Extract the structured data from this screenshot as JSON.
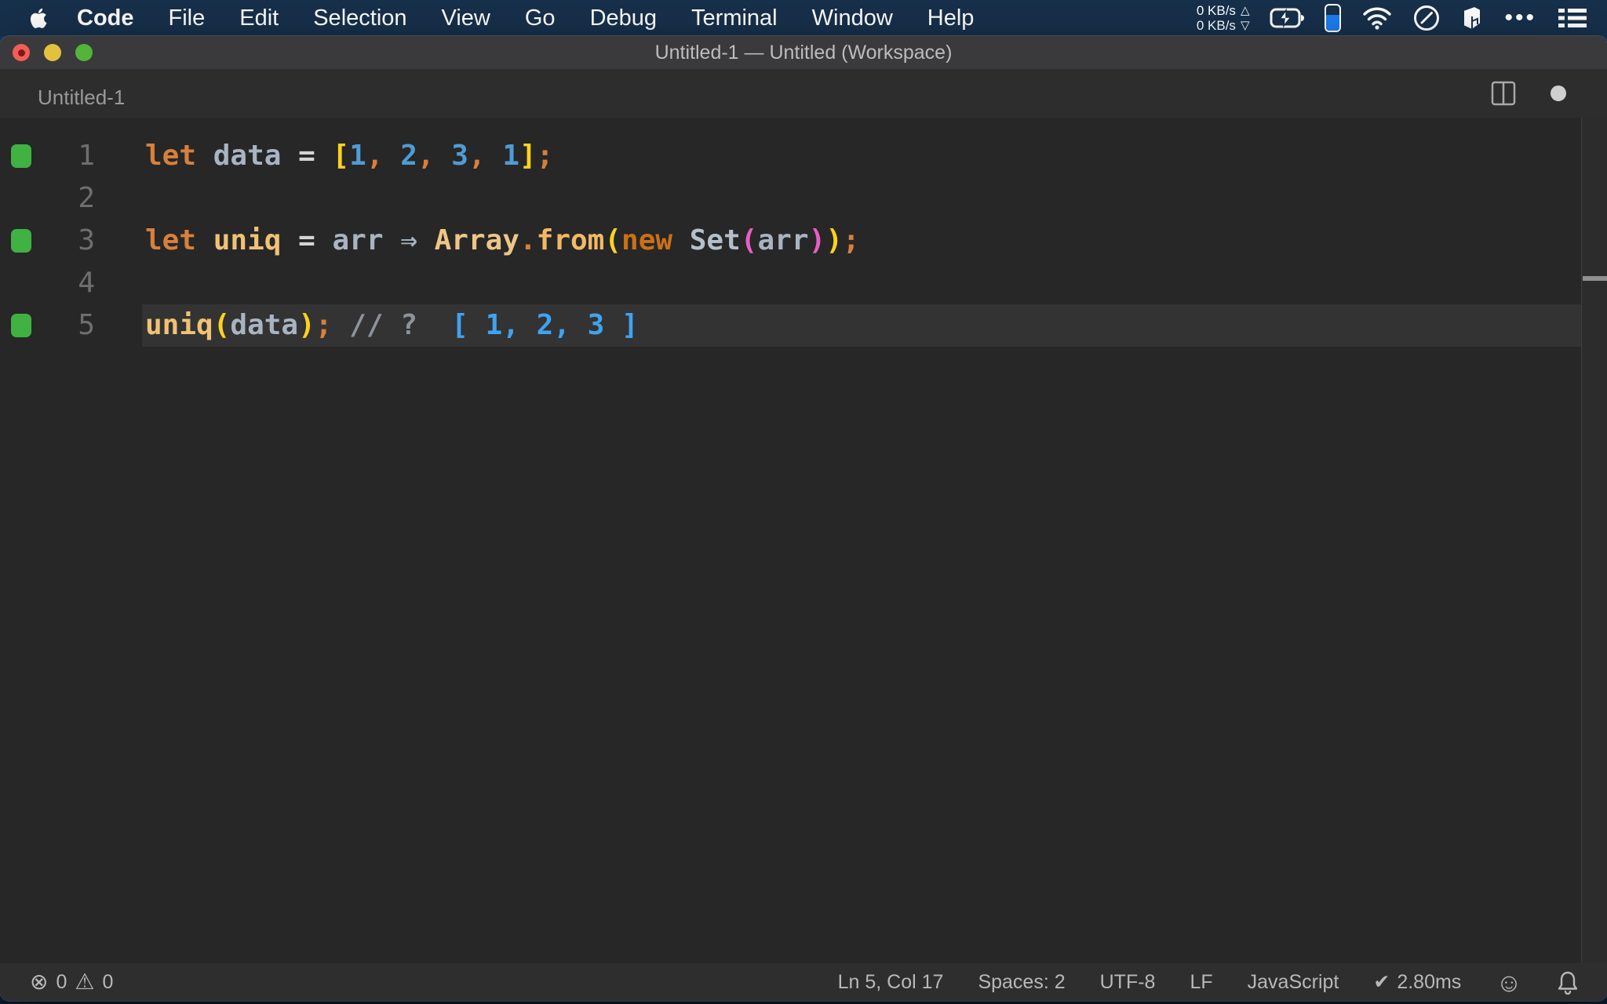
{
  "menu_bar": {
    "items": [
      "Code",
      "File",
      "Edit",
      "Selection",
      "View",
      "Go",
      "Debug",
      "Terminal",
      "Window",
      "Help"
    ],
    "bold_item": "Code",
    "network": {
      "up_value": "0 KB/s",
      "down_value": "0 KB/s"
    }
  },
  "icons": {
    "up_triangle": "△",
    "down_triangle": "▽",
    "ellipsis": "•••",
    "error_glyph": "⊗",
    "warning_glyph": "⚠",
    "check_glyph": "✔",
    "smiley_glyph": "☺"
  },
  "window": {
    "title": "Untitled-1 — Untitled (Workspace)",
    "tab": {
      "label": "Untitled-1"
    }
  },
  "editor": {
    "language_hint": "JavaScript",
    "palette": {
      "kw": "#d8803a",
      "newkw": "#cb7016",
      "eq": "#d4d4d4",
      "ident": "#a8b4c2",
      "setcls": "#b3bfca",
      "fname": "#f2b964",
      "tan": "#edc687",
      "fnvar": "#f0c276",
      "num": "#4f9cd6",
      "by": "#ffd21e",
      "bp": "#e75fc4",
      "comment": "#8d939c",
      "result": "#3fa3f0",
      "": "#a8b4c2"
    },
    "lines": [
      {
        "n": "1",
        "marker": true,
        "current": false,
        "tokens": [
          [
            "let",
            "kw"
          ],
          [
            " ",
            ""
          ],
          [
            "data",
            "ident"
          ],
          [
            " ",
            ""
          ],
          [
            "=",
            "eq"
          ],
          [
            " ",
            ""
          ],
          [
            "[",
            "by"
          ],
          [
            "1",
            "num"
          ],
          [
            ",",
            "kw"
          ],
          [
            " ",
            ""
          ],
          [
            "2",
            "num"
          ],
          [
            ",",
            "kw"
          ],
          [
            " ",
            ""
          ],
          [
            "3",
            "num"
          ],
          [
            ",",
            "kw"
          ],
          [
            " ",
            ""
          ],
          [
            "1",
            "num"
          ],
          [
            "]",
            "by"
          ],
          [
            ";",
            "kw"
          ]
        ]
      },
      {
        "n": "2",
        "marker": false,
        "current": false,
        "tokens": []
      },
      {
        "n": "3",
        "marker": true,
        "current": false,
        "tokens": [
          [
            "let",
            "kw"
          ],
          [
            " ",
            ""
          ],
          [
            "uniq",
            "fnvar"
          ],
          [
            " ",
            ""
          ],
          [
            "=",
            "eq"
          ],
          [
            " ",
            ""
          ],
          [
            "arr",
            "ident"
          ],
          [
            " ",
            ""
          ],
          [
            "⇒",
            "ident"
          ],
          [
            " ",
            ""
          ],
          [
            "Array",
            "tan"
          ],
          [
            ".",
            "kw"
          ],
          [
            "from",
            "fname"
          ],
          [
            "(",
            "by"
          ],
          [
            "new",
            "newkw"
          ],
          [
            " ",
            ""
          ],
          [
            "Set",
            "setcls"
          ],
          [
            "(",
            "bp"
          ],
          [
            "arr",
            "ident"
          ],
          [
            ")",
            "bp"
          ],
          [
            ")",
            "by"
          ],
          [
            ";",
            "kw"
          ]
        ]
      },
      {
        "n": "4",
        "marker": false,
        "current": false,
        "tokens": []
      },
      {
        "n": "5",
        "marker": true,
        "current": true,
        "tokens": [
          [
            "uniq",
            "fnvar"
          ],
          [
            "(",
            "by"
          ],
          [
            "data",
            "ident"
          ],
          [
            ")",
            "by"
          ],
          [
            ";",
            "kw"
          ],
          [
            " ",
            ""
          ],
          [
            "//",
            "comment"
          ],
          [
            " ",
            ""
          ],
          [
            "?",
            "comment"
          ],
          [
            "  ",
            ""
          ],
          [
            "[ 1, 2, 3 ]",
            "result"
          ]
        ]
      }
    ]
  },
  "status_bar": {
    "errors": "0",
    "warnings": "0",
    "items": [
      {
        "name": "cursor-position",
        "label": "Ln 5, Col 17"
      },
      {
        "name": "indentation",
        "label": "Spaces: 2"
      },
      {
        "name": "encoding",
        "label": "UTF-8"
      },
      {
        "name": "eol-sequence",
        "label": "LF"
      },
      {
        "name": "language-mode",
        "label": "JavaScript"
      },
      {
        "name": "quokka-time",
        "icon": "check_glyph",
        "label": "2.80ms"
      }
    ]
  }
}
